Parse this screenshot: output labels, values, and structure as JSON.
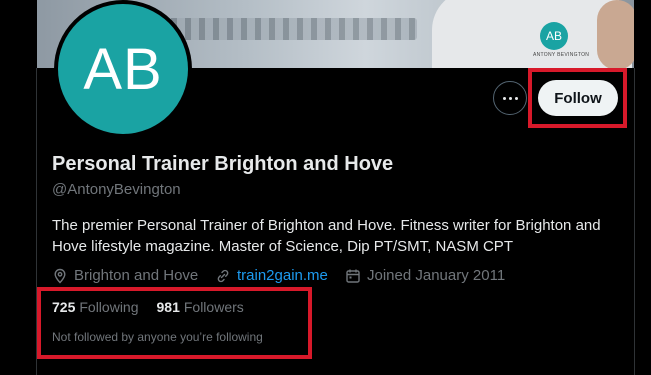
{
  "banner": {
    "shirt_logo_text": "AB",
    "shirt_text": "ANTONY BEVINGTON"
  },
  "avatar": {
    "initials": "AB",
    "bg_color": "#1aa3a3"
  },
  "actions": {
    "more_label": "More",
    "follow_label": "Follow"
  },
  "profile": {
    "name": "Personal Trainer Brighton and Hove",
    "handle": "@AntonyBevington",
    "bio": "The premier Personal Trainer of Brighton and Hove. Fitness writer for Brighton and Hove lifestyle magazine. Master of Science, Dip PT/SMT, NASM CPT",
    "location": "Brighton and Hove",
    "website": "train2gain.me",
    "joined": "Joined January 2011"
  },
  "stats": {
    "following_count": "725",
    "following_label": "Following",
    "followers_count": "981",
    "followers_label": "Followers",
    "not_followed_text": "Not followed by anyone you’re following"
  },
  "colors": {
    "accent_link": "#1d9bf0",
    "highlight": "#d7192a",
    "background": "#000000"
  },
  "icons": [
    "location-icon",
    "link-icon",
    "calendar-icon",
    "more-dots-icon"
  ]
}
